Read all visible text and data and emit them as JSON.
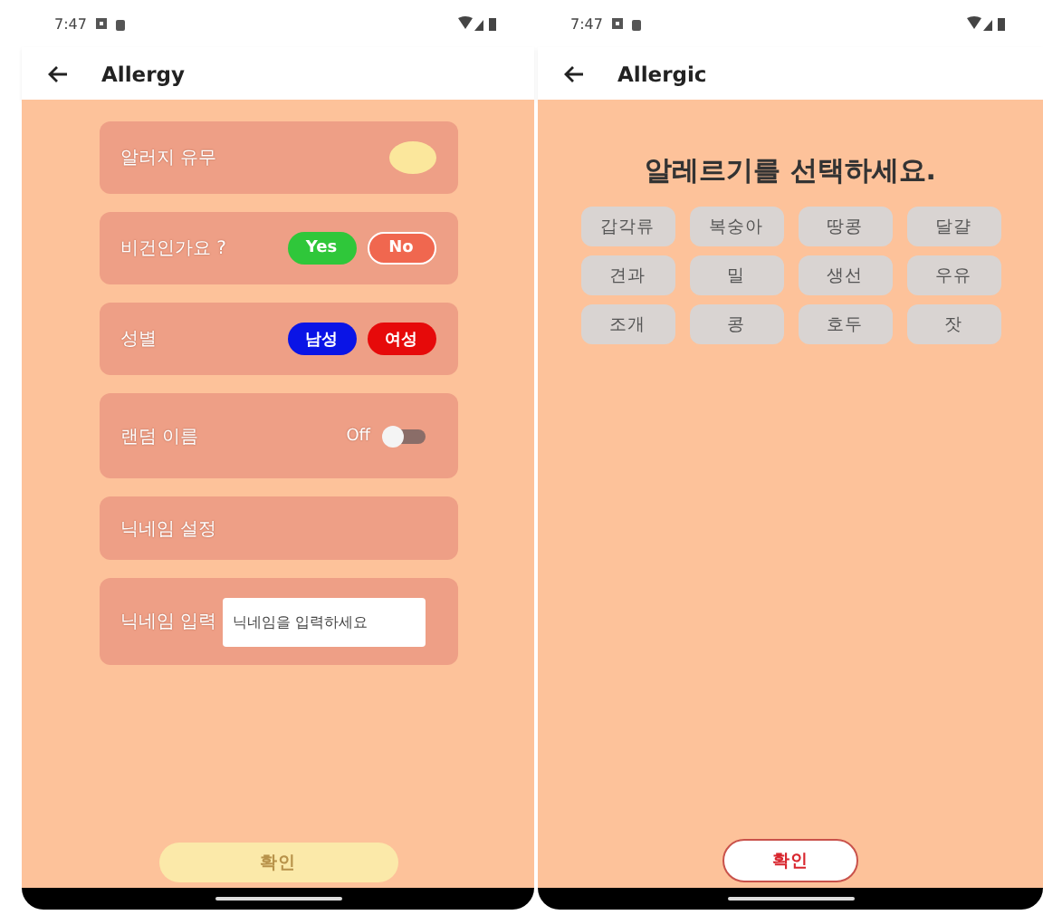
{
  "screens": [
    {
      "status_time": "7:47",
      "title": "Allergy",
      "kind": "settings",
      "rows": [
        {
          "kind": "toggle",
          "label": "알러지 유무",
          "on": true
        },
        {
          "kind": "choice",
          "label": "비건인가요 ?",
          "options": [
            {
              "label": "Yes",
              "color": "#2fc73a",
              "selected": false
            },
            {
              "label": "No",
              "color": "#f0674f",
              "selected": true
            }
          ]
        },
        {
          "kind": "choice",
          "label": "성별",
          "options": [
            {
              "label": "남성",
              "color": "#0a14e6",
              "selected": false
            },
            {
              "label": "여성",
              "color": "#e60a0a",
              "selected": false
            }
          ]
        },
        {
          "kind": "switch",
          "label": "랜덤 이름",
          "value_text": "Off",
          "on": false
        },
        {
          "kind": "label",
          "label": "닉네임 설정"
        },
        {
          "kind": "input",
          "label": "닉네임 입력",
          "placeholder": "닉네임을 입력하세요"
        }
      ],
      "confirm": {
        "label": "확인",
        "disabled": true
      }
    },
    {
      "status_time": "7:47",
      "title": "Allergic",
      "kind": "grid",
      "heading": "알레르기를 선택하세요.",
      "chips": [
        {
          "label": "갑각류",
          "selected": false
        },
        {
          "label": "복숭아",
          "selected": false
        },
        {
          "label": "땅콩",
          "selected": false
        },
        {
          "label": "달걀",
          "selected": false
        },
        {
          "label": "견과",
          "selected": false
        },
        {
          "label": "밀",
          "selected": false
        },
        {
          "label": "생선",
          "selected": false
        },
        {
          "label": "우유",
          "selected": false
        },
        {
          "label": "조개",
          "selected": false
        },
        {
          "label": "콩",
          "selected": false
        },
        {
          "label": "호두",
          "selected": false
        },
        {
          "label": "잣",
          "selected": false
        }
      ],
      "confirm": {
        "label": "확인",
        "disabled": false
      }
    }
  ]
}
